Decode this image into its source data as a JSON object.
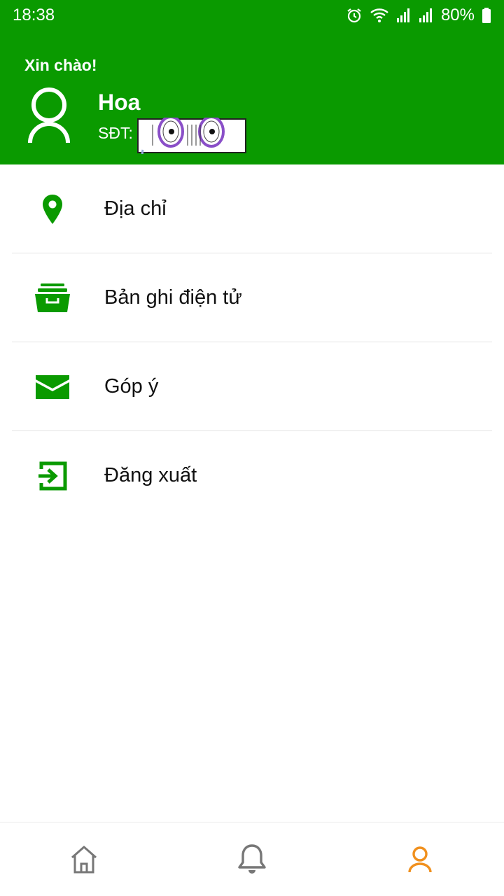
{
  "status_bar": {
    "time": "18:38",
    "battery": "80%"
  },
  "header": {
    "greeting": "Xin chào!",
    "user_name": "Hoa",
    "phone_label": "SĐT:",
    "brand_color": "#0a9a00"
  },
  "menu": {
    "items": [
      {
        "label": "Địa chỉ",
        "icon": "location-pin-icon"
      },
      {
        "label": "Bản ghi điện tử",
        "icon": "archive-box-icon"
      },
      {
        "label": "Góp ý",
        "icon": "envelope-icon"
      },
      {
        "label": "Đăng xuất",
        "icon": "logout-icon"
      }
    ]
  },
  "bottom_nav": {
    "items": [
      {
        "icon": "home-icon",
        "active": false
      },
      {
        "icon": "bell-icon",
        "active": false
      },
      {
        "icon": "user-icon",
        "active": true
      }
    ],
    "active_color": "#f0901e",
    "inactive_color": "#777777"
  }
}
